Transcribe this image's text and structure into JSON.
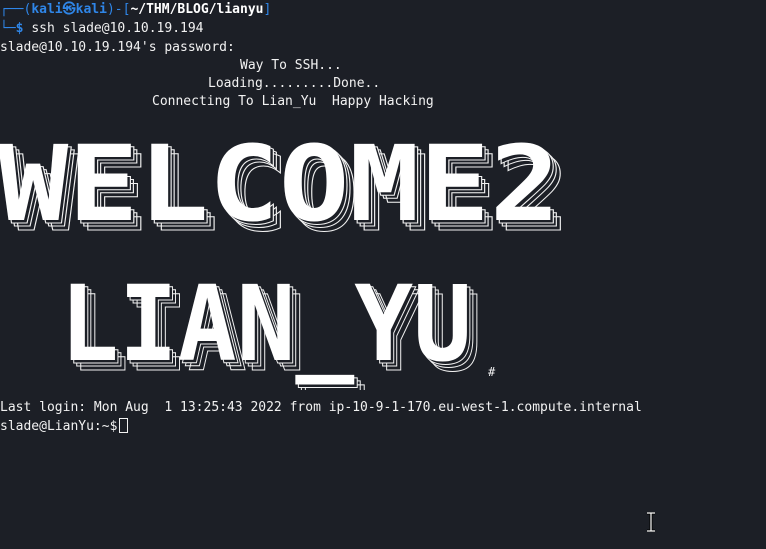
{
  "prompt": {
    "frame_open": "┌──(",
    "user": "kali",
    "at": "㉿",
    "host": "kali",
    "frame_mid": ")-[",
    "path": "~/THM/BLOG/lianyu",
    "frame_close": "]",
    "frame_bottom": "└─",
    "dollar": "$",
    "command": "ssh slade@10.10.19.194"
  },
  "output": {
    "password_prompt": "slade@10.10.19.194's password:",
    "banner_line1": "Way To SSH...",
    "banner_line2": "Loading.........Done..",
    "banner_line3": "Connecting To Lian_Yu  Happy Hacking",
    "art_row1": "WELCOME2",
    "art_row2": "LIAN_YU",
    "art_hash": "#",
    "last_login": "Last login: Mon Aug  1 13:25:43 2022 from ip-10-9-1-170.eu-west-1.compute.internal",
    "remote_prompt": "slade@LianYu:~$"
  },
  "colors": {
    "background": "#1c1f26",
    "text": "#f2f2f2",
    "accent": "#2f86e8"
  },
  "icons": {
    "cursor": "block-cursor-icon",
    "mouse": "text-ibeam-icon"
  }
}
